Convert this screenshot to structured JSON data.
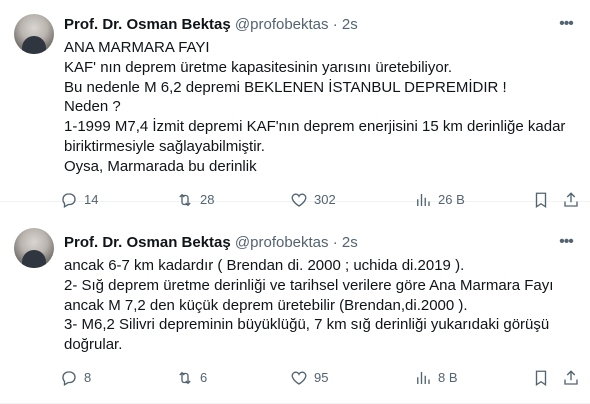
{
  "tweets": [
    {
      "author_name": "Prof. Dr. Osman Bektaş",
      "handle": "@profobektas",
      "separator": "·",
      "time": "2s",
      "lines": [
        "ANA MARMARA FAYI",
        "KAF' nın deprem üretme kapasitesinin   yarısını üretebiliyor.",
        "Bu nedenle M 6,2 depremi BEKLENEN  İSTANBUL DEPREMİDIR !",
        "Neden ?",
        "1-1999 M7,4 İzmit depremi KAF'nın deprem enerjisini 15 km derinliğe kadar",
        "biriktirmesiyle sağlayabilmiştir.",
        "Oysa, Marmarada bu derinlik"
      ],
      "replies": "14",
      "retweets": "28",
      "likes": "302",
      "views": "26 B"
    },
    {
      "author_name": "Prof. Dr. Osman Bektaş",
      "handle": "@profobektas",
      "separator": "·",
      "time": "2s",
      "lines": [
        "ancak 6-7 km kadardır ( Brendan di. 2000 ; uchida di.2019 ).",
        "2- Sığ deprem üretme derinliği ve tarihsel verilere göre Ana Marmara Fayı",
        "ancak M 7,2 den küçük deprem üretebilir (Brendan,di.2000 ).",
        "3- M6,2 Silivri depreminin büyüklüğü, 7 km sığ derinliği yukarıdaki görüşü",
        "doğrular."
      ],
      "replies": "8",
      "retweets": "6",
      "likes": "95",
      "views": "8 B"
    }
  ]
}
